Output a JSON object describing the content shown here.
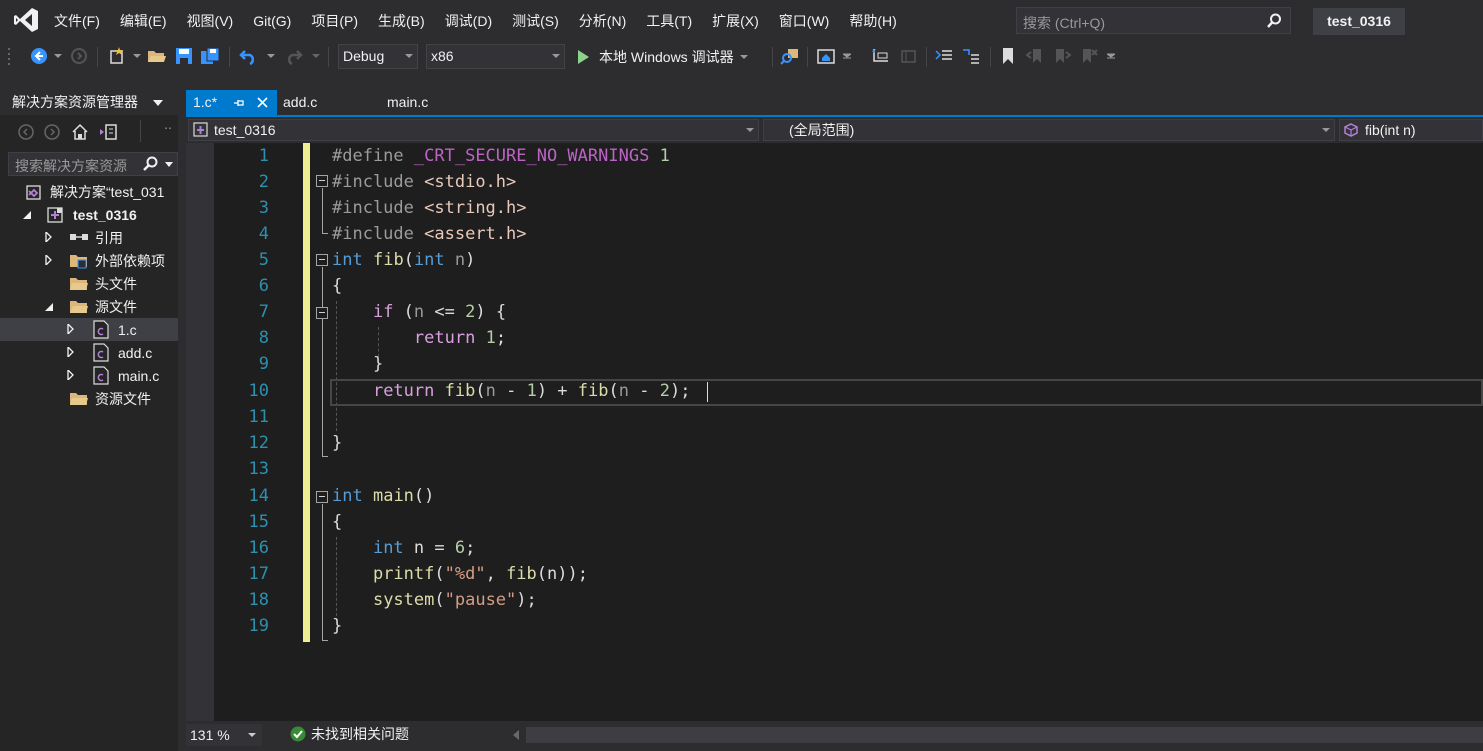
{
  "menu": {
    "items": [
      "文件(F)",
      "编辑(E)",
      "视图(V)",
      "Git(G)",
      "项目(P)",
      "生成(B)",
      "调试(D)",
      "测试(S)",
      "分析(N)",
      "工具(T)",
      "扩展(X)",
      "窗口(W)",
      "帮助(H)"
    ],
    "search_placeholder": "搜索 (Ctrl+Q)",
    "solution_title": "test_0316"
  },
  "toolbar": {
    "config": "Debug",
    "platform": "x86",
    "run_label": "本地 Windows 调试器"
  },
  "solution_explorer": {
    "title": "解决方案资源管理器",
    "search_placeholder": "搜索解决方案资源",
    "tree": [
      {
        "label": "解决方案“test_031",
        "bold": false
      },
      {
        "label": "test_0316",
        "bold": true
      },
      {
        "label": "引用"
      },
      {
        "label": "外部依赖项"
      },
      {
        "label": "头文件"
      },
      {
        "label": "源文件"
      },
      {
        "label": "1.c",
        "selected": true
      },
      {
        "label": "add.c"
      },
      {
        "label": "main.c"
      },
      {
        "label": "资源文件"
      }
    ]
  },
  "tabs": [
    {
      "label": "1.c*",
      "active": true
    },
    {
      "label": "add.c"
    },
    {
      "label": "main.c"
    }
  ],
  "navbar": {
    "project": "test_0316",
    "scope": "(全局范围)",
    "member": "fib(int n)"
  },
  "code": {
    "line_numbers": [
      "1",
      "2",
      "3",
      "4",
      "5",
      "6",
      "7",
      "8",
      "9",
      "10",
      "11",
      "12",
      "13",
      "14",
      "15",
      "16",
      "17",
      "18",
      "19"
    ]
  },
  "status": {
    "zoom": "131 %",
    "issues": "未找到相关问题"
  },
  "colors": {
    "accent": "#007acc",
    "editor_bg": "#1e1e1e",
    "change_bar": "#efef91"
  }
}
